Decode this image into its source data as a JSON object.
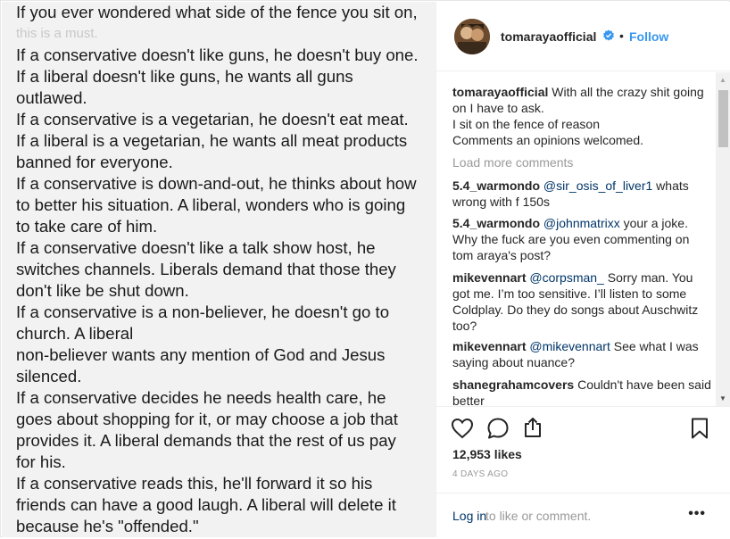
{
  "image_text": {
    "lines": [
      "If you ever wondered what side of the fence you sit on,",
      "this is a must.",
      "If a conservative doesn't like guns, he doesn't buy one.",
      "If a liberal doesn't like guns, he wants all guns",
      "outlawed.",
      "If a conservative is a vegetarian, he doesn't eat meat.",
      "If a liberal is a vegetarian, he wants all meat products",
      "banned for everyone.",
      "If a conservative is down-and-out, he thinks about how",
      "to better his situation. A liberal, wonders who is going",
      "to take care of him.",
      "If a conservative doesn't like a talk show host, he",
      "switches channels. Liberals demand that those they",
      "don't like be shut down.",
      "If a conservative is a non-believer, he doesn't go to",
      "church. A liberal",
      "non-believer wants any mention of God and Jesus",
      "silenced.",
      "If a conservative decides he needs health care, he",
      "goes about shopping for it, or may choose a job that",
      "provides it. A liberal demands that the rest of us pay",
      "for his.",
      "If a conservative reads this, he'll forward it so his",
      "friends can have a good laugh. A liberal will delete it",
      "because he's \"offended.\""
    ]
  },
  "header": {
    "username": "tomarayaofficial",
    "separator": "•",
    "follow_label": "Follow"
  },
  "caption": {
    "username": "tomarayaofficial",
    "text": "With all the crazy shit going on I have to ask.",
    "line2": "I sit on the fence of reason",
    "line3": "Comments an opinions welcomed."
  },
  "load_more": "Load more comments",
  "comments": [
    {
      "user": "5.4_warmondo",
      "mention": "@sir_osis_of_liver1",
      "text": " whats wrong with f 150s"
    },
    {
      "user": "5.4_warmondo",
      "mention": "@johnmatrixx",
      "text": " your a joke. Why the fuck are you even commenting on tom araya's post?"
    },
    {
      "user": "mikevennart",
      "mention": "@corpsman_",
      "text": " Sorry man. You got me. I’m too sensitive. I’ll listen to some Coldplay. Do they do songs about Auschwitz too?"
    },
    {
      "user": "mikevennart",
      "mention": "@mikevennart",
      "text": " See what I was saying about nuance?"
    },
    {
      "user": "shanegrahamcovers",
      "mention": "",
      "text": " Couldn't have been said better"
    }
  ],
  "likes": "12,953 likes",
  "date": "4 DAYS AGO",
  "login": {
    "link": "Log in",
    "rest": " to like or comment."
  },
  "more_label": "•••",
  "icons": {
    "like": "heart-icon",
    "comment": "comment-icon",
    "share": "share-icon",
    "save": "bookmark-icon",
    "verified": "verified-badge-icon"
  },
  "colors": {
    "link_blue": "#3897f0",
    "mention_blue": "#003569",
    "muted": "#999999",
    "text": "#262626"
  }
}
